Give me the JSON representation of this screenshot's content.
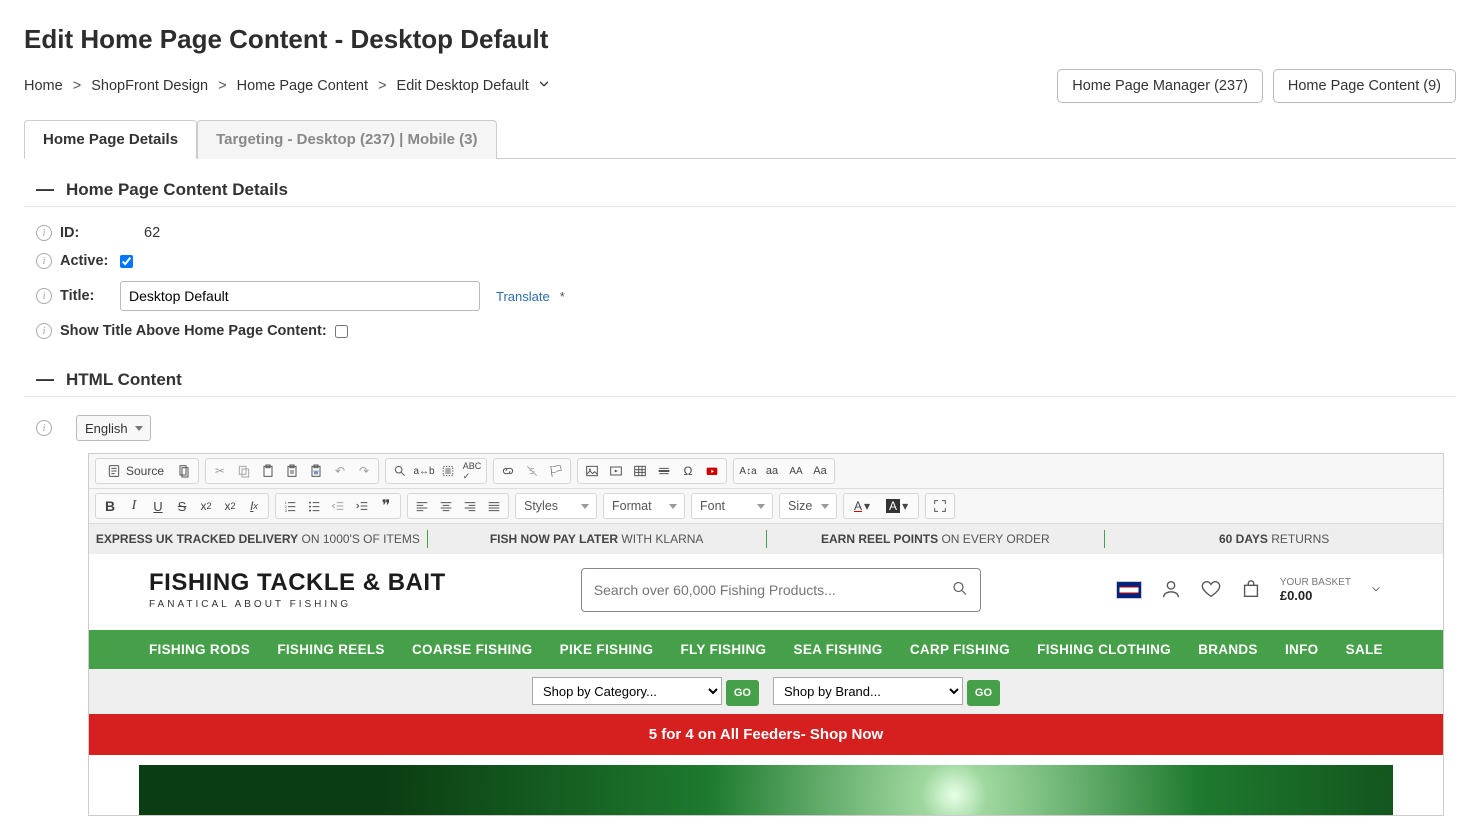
{
  "page_title": "Edit Home Page Content - Desktop Default",
  "breadcrumb": {
    "items": [
      "Home",
      "ShopFront Design",
      "Home Page Content",
      "Edit Desktop Default"
    ]
  },
  "header_actions": {
    "manager": "Home Page Manager (237)",
    "content": "Home Page Content (9)"
  },
  "tabs": {
    "details": "Home Page Details",
    "targeting": "Targeting - Desktop (237) | Mobile (3)"
  },
  "section_details_title": "Home Page Content Details",
  "section_html_title": "HTML Content",
  "fields": {
    "id_label": "ID:",
    "id_value": "62",
    "active_label": "Active:",
    "active_checked": true,
    "title_label": "Title:",
    "title_value": "Desktop Default",
    "translate": "Translate",
    "show_title_label": "Show Title Above Home Page Content:",
    "show_title_checked": false
  },
  "language_selector": "English",
  "toolbar": {
    "source": "Source",
    "styles": "Styles",
    "format": "Format",
    "font": "Font",
    "size": "Size",
    "aa_small": "aa",
    "aa_caps": "AA",
    "aa_mixed": "Aa"
  },
  "preview": {
    "benefits": [
      {
        "bold": "EXPRESS UK TRACKED DELIVERY",
        "rest": " ON 1000'S OF ITEMS"
      },
      {
        "bold": "FISH NOW PAY LATER",
        "rest": " WITH KLARNA"
      },
      {
        "bold": "EARN REEL POINTS",
        "rest": " ON EVERY ORDER"
      },
      {
        "bold": "60 DAYS",
        "rest": " RETURNS"
      }
    ],
    "logo_main": "FISHING TACKLE & BAIT",
    "logo_sub": "FANATICAL ABOUT FISHING",
    "search_placeholder": "Search over 60,000 Fishing Products...",
    "basket_label": "YOUR BASKET",
    "basket_value": "£0.00",
    "nav": [
      "FISHING RODS",
      "FISHING REELS",
      "COARSE FISHING",
      "PIKE FISHING",
      "FLY FISHING",
      "SEA FISHING",
      "CARP FISHING",
      "FISHING CLOTHING",
      "BRANDS",
      "INFO",
      "SALE"
    ],
    "select_category": "Shop by Category...",
    "select_brand": "Shop by Brand...",
    "go": "GO",
    "promo": "5 for 4 on All Feeders- Shop Now"
  }
}
